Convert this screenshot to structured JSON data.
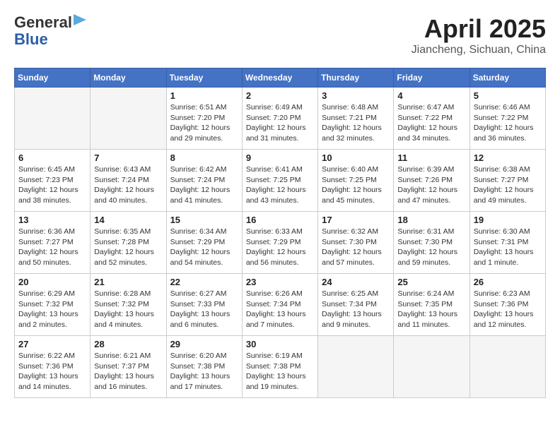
{
  "header": {
    "logo_line1": "General",
    "logo_line2": "Blue",
    "month": "April 2025",
    "location": "Jiancheng, Sichuan, China"
  },
  "weekdays": [
    "Sunday",
    "Monday",
    "Tuesday",
    "Wednesday",
    "Thursday",
    "Friday",
    "Saturday"
  ],
  "days": [
    {
      "num": "",
      "sunrise": "",
      "sunset": "",
      "daylight": ""
    },
    {
      "num": "",
      "sunrise": "",
      "sunset": "",
      "daylight": ""
    },
    {
      "num": "1",
      "sunrise": "6:51 AM",
      "sunset": "7:20 PM",
      "daylight": "12 hours and 29 minutes."
    },
    {
      "num": "2",
      "sunrise": "6:49 AM",
      "sunset": "7:20 PM",
      "daylight": "12 hours and 31 minutes."
    },
    {
      "num": "3",
      "sunrise": "6:48 AM",
      "sunset": "7:21 PM",
      "daylight": "12 hours and 32 minutes."
    },
    {
      "num": "4",
      "sunrise": "6:47 AM",
      "sunset": "7:22 PM",
      "daylight": "12 hours and 34 minutes."
    },
    {
      "num": "5",
      "sunrise": "6:46 AM",
      "sunset": "7:22 PM",
      "daylight": "12 hours and 36 minutes."
    },
    {
      "num": "6",
      "sunrise": "6:45 AM",
      "sunset": "7:23 PM",
      "daylight": "12 hours and 38 minutes."
    },
    {
      "num": "7",
      "sunrise": "6:43 AM",
      "sunset": "7:24 PM",
      "daylight": "12 hours and 40 minutes."
    },
    {
      "num": "8",
      "sunrise": "6:42 AM",
      "sunset": "7:24 PM",
      "daylight": "12 hours and 41 minutes."
    },
    {
      "num": "9",
      "sunrise": "6:41 AM",
      "sunset": "7:25 PM",
      "daylight": "12 hours and 43 minutes."
    },
    {
      "num": "10",
      "sunrise": "6:40 AM",
      "sunset": "7:25 PM",
      "daylight": "12 hours and 45 minutes."
    },
    {
      "num": "11",
      "sunrise": "6:39 AM",
      "sunset": "7:26 PM",
      "daylight": "12 hours and 47 minutes."
    },
    {
      "num": "12",
      "sunrise": "6:38 AM",
      "sunset": "7:27 PM",
      "daylight": "12 hours and 49 minutes."
    },
    {
      "num": "13",
      "sunrise": "6:36 AM",
      "sunset": "7:27 PM",
      "daylight": "12 hours and 50 minutes."
    },
    {
      "num": "14",
      "sunrise": "6:35 AM",
      "sunset": "7:28 PM",
      "daylight": "12 hours and 52 minutes."
    },
    {
      "num": "15",
      "sunrise": "6:34 AM",
      "sunset": "7:29 PM",
      "daylight": "12 hours and 54 minutes."
    },
    {
      "num": "16",
      "sunrise": "6:33 AM",
      "sunset": "7:29 PM",
      "daylight": "12 hours and 56 minutes."
    },
    {
      "num": "17",
      "sunrise": "6:32 AM",
      "sunset": "7:30 PM",
      "daylight": "12 hours and 57 minutes."
    },
    {
      "num": "18",
      "sunrise": "6:31 AM",
      "sunset": "7:30 PM",
      "daylight": "12 hours and 59 minutes."
    },
    {
      "num": "19",
      "sunrise": "6:30 AM",
      "sunset": "7:31 PM",
      "daylight": "13 hours and 1 minute."
    },
    {
      "num": "20",
      "sunrise": "6:29 AM",
      "sunset": "7:32 PM",
      "daylight": "13 hours and 2 minutes."
    },
    {
      "num": "21",
      "sunrise": "6:28 AM",
      "sunset": "7:32 PM",
      "daylight": "13 hours and 4 minutes."
    },
    {
      "num": "22",
      "sunrise": "6:27 AM",
      "sunset": "7:33 PM",
      "daylight": "13 hours and 6 minutes."
    },
    {
      "num": "23",
      "sunrise": "6:26 AM",
      "sunset": "7:34 PM",
      "daylight": "13 hours and 7 minutes."
    },
    {
      "num": "24",
      "sunrise": "6:25 AM",
      "sunset": "7:34 PM",
      "daylight": "13 hours and 9 minutes."
    },
    {
      "num": "25",
      "sunrise": "6:24 AM",
      "sunset": "7:35 PM",
      "daylight": "13 hours and 11 minutes."
    },
    {
      "num": "26",
      "sunrise": "6:23 AM",
      "sunset": "7:36 PM",
      "daylight": "13 hours and 12 minutes."
    },
    {
      "num": "27",
      "sunrise": "6:22 AM",
      "sunset": "7:36 PM",
      "daylight": "13 hours and 14 minutes."
    },
    {
      "num": "28",
      "sunrise": "6:21 AM",
      "sunset": "7:37 PM",
      "daylight": "13 hours and 16 minutes."
    },
    {
      "num": "29",
      "sunrise": "6:20 AM",
      "sunset": "7:38 PM",
      "daylight": "13 hours and 17 minutes."
    },
    {
      "num": "30",
      "sunrise": "6:19 AM",
      "sunset": "7:38 PM",
      "daylight": "13 hours and 19 minutes."
    },
    {
      "num": "",
      "sunrise": "",
      "sunset": "",
      "daylight": ""
    },
    {
      "num": "",
      "sunrise": "",
      "sunset": "",
      "daylight": ""
    },
    {
      "num": "",
      "sunrise": "",
      "sunset": "",
      "daylight": ""
    }
  ]
}
